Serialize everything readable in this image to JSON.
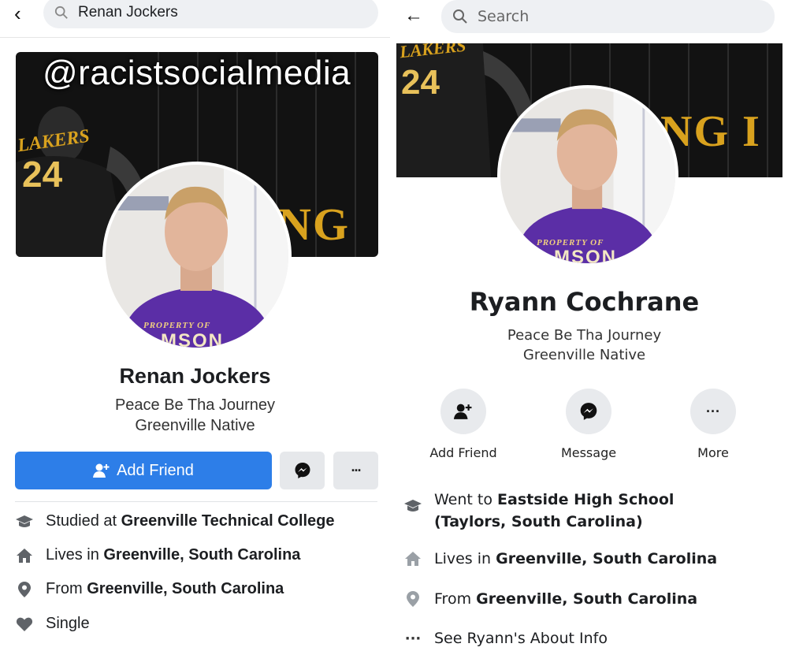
{
  "left": {
    "search": {
      "value": "Renan Jockers"
    },
    "cover": {
      "watermark": "@racistsocialmedia",
      "jersey_team": "LAKERS",
      "jersey_number": "24",
      "banner_text": "NG I"
    },
    "avatar": {
      "shirt_text_1": "PROPERTY OF",
      "shirt_text_2": "MSON"
    },
    "profile": {
      "name": "Renan Jockers",
      "bio_line1": "Peace Be Tha Journey",
      "bio_line2": "Greenville Native"
    },
    "buttons": {
      "add_friend": "Add Friend",
      "more_glyph": "···"
    },
    "info": [
      {
        "icon": "graduation-cap-icon",
        "prefix": "Studied at ",
        "value": "Greenville Technical College"
      },
      {
        "icon": "house-icon",
        "prefix": "Lives in ",
        "value": "Greenville, South Carolina"
      },
      {
        "icon": "location-pin-icon",
        "prefix": "From ",
        "value": "Greenville, South Carolina"
      },
      {
        "icon": "heart-icon",
        "prefix": "",
        "value": "Single"
      }
    ]
  },
  "right": {
    "search": {
      "placeholder": "Search"
    },
    "cover": {
      "jersey_team": "LAKERS",
      "jersey_number": "24",
      "banner_text": "NG I"
    },
    "avatar": {
      "shirt_text_1": "PROPERTY OF",
      "shirt_text_2": "MSON"
    },
    "profile": {
      "name": "Ryann Cochrane",
      "bio_line1": "Peace Be Tha Journey",
      "bio_line2": "Greenville Native"
    },
    "actions": [
      {
        "icon": "add-friend-icon",
        "label": "Add Friend"
      },
      {
        "icon": "messenger-icon",
        "label": "Message"
      },
      {
        "icon": "more-icon",
        "label": "More"
      }
    ],
    "info": [
      {
        "icon": "graduation-cap-icon",
        "prefix": "Went to ",
        "value": "Eastside High School (Taylors, South Carolina)"
      },
      {
        "icon": "house-icon",
        "prefix": "Lives in ",
        "value": "Greenville, South Carolina"
      },
      {
        "icon": "location-pin-icon",
        "prefix": "From ",
        "value": "Greenville, South Carolina"
      },
      {
        "icon": "more-dots-icon",
        "prefix": "",
        "value": "See Ryann's About Info"
      }
    ]
  },
  "colors": {
    "facebook_blue": "#2d7ee8",
    "gold": "#d9a21e",
    "purple_shirt": "#5b2ea6",
    "icon_grey": "#5f6368"
  }
}
